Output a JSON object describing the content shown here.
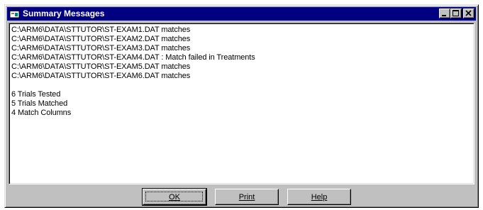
{
  "window": {
    "title": "Summary Messages",
    "icon": "app-window-icon",
    "controls": [
      "minimize-icon",
      "maximize-icon",
      "close-icon"
    ]
  },
  "messages": {
    "lines": [
      "C:\\ARM6\\DATA\\STTUTOR\\ST-EXAM1.DAT matches",
      "C:\\ARM6\\DATA\\STTUTOR\\ST-EXAM2.DAT matches",
      "C:\\ARM6\\DATA\\STTUTOR\\ST-EXAM3.DAT matches",
      "C:\\ARM6\\DATA\\STTUTOR\\ST-EXAM4.DAT : Match failed in Treatments",
      "C:\\ARM6\\DATA\\STTUTOR\\ST-EXAM5.DAT matches",
      "C:\\ARM6\\DATA\\STTUTOR\\ST-EXAM6.DAT matches",
      "",
      "6 Trials Tested",
      "5 Trials Matched",
      "4 Match Columns"
    ]
  },
  "buttons": {
    "ok": "OK",
    "print": "Print",
    "help": "Help"
  }
}
